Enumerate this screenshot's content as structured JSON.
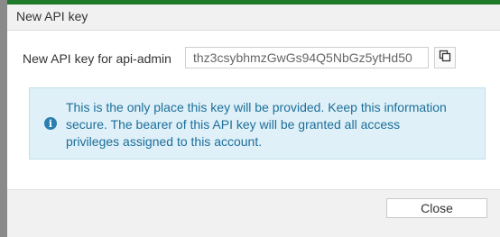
{
  "dialog": {
    "title": "New API key",
    "accent_color": "#1f7a2a",
    "key_label": "New API key for api-admin",
    "key_value": "thz3csybhmzGwGs94Q5NbGz5ytHd50",
    "copy_icon": "copy-icon",
    "info_icon": "info-icon",
    "info_message": "This is the only place this key will be provided. Keep this information secure. The bearer of this API key will be granted all access privileges assigned to this account.",
    "info_color": "#1d6f9a",
    "close_label": "Close"
  }
}
